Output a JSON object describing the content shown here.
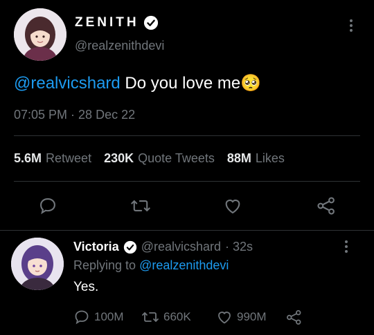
{
  "tweet": {
    "author_name": "ZENITH",
    "author_handle": "@realzenithdevi",
    "mention": "@realvicshard",
    "text": "Do you love me",
    "emoji": "🥺",
    "timestamp": "07:05 PM · 28 Dec 22",
    "stats": {
      "retweets": "5.6M",
      "retweets_label": "Retweet",
      "quotes": "230K",
      "quotes_label": "Quote Tweets",
      "likes": "88M",
      "likes_label": "Likes"
    }
  },
  "reply": {
    "author_name": "Victoria",
    "author_handle": "@realvicshard",
    "time_ago": "· 32s",
    "replying_prefix": "Replying to",
    "replying_to": "@realzenithdevi",
    "text": "Yes.",
    "replies": "100M",
    "retweets": "660K",
    "likes": "990M"
  },
  "colors": {
    "background": "#000000",
    "text": "#e7e9ea",
    "muted": "#71767b",
    "accent": "#1d9bf0",
    "divider": "#2f3336"
  }
}
